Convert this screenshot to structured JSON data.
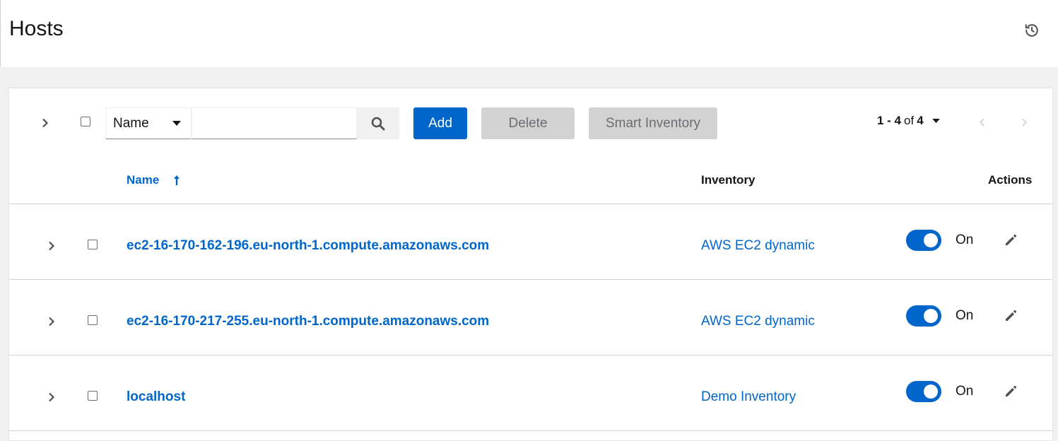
{
  "page": {
    "title": "Hosts"
  },
  "toolbar": {
    "filter_field": "Name",
    "search_value": "",
    "add_label": "Add",
    "delete_label": "Delete",
    "smart_inventory_label": "Smart Inventory",
    "pagination": {
      "range": "1 - 4",
      "of": "of",
      "total": "4"
    }
  },
  "table": {
    "columns": {
      "name": "Name",
      "inventory": "Inventory",
      "actions": "Actions"
    },
    "sort": {
      "column": "Name",
      "direction": "ascending"
    },
    "rows": [
      {
        "name": "ec2-16-170-162-196.eu-north-1.compute.amazonaws.com",
        "inventory": "AWS EC2 dynamic",
        "enabled": true,
        "toggle_label": "On"
      },
      {
        "name": "ec2-16-170-217-255.eu-north-1.compute.amazonaws.com",
        "inventory": "AWS EC2 dynamic",
        "enabled": true,
        "toggle_label": "On"
      },
      {
        "name": "localhost",
        "inventory": "Demo Inventory",
        "enabled": true,
        "toggle_label": "On"
      }
    ]
  },
  "colors": {
    "primary": "#0066cc",
    "disabled_bg": "#d2d2d2",
    "page_bg": "#f0f0f0"
  }
}
